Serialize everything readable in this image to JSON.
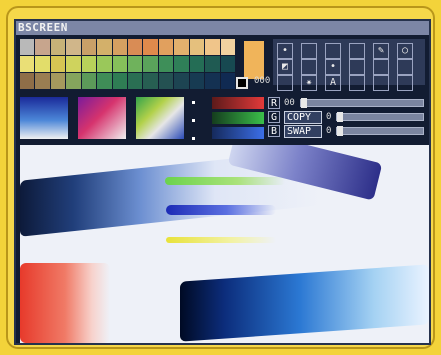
{
  "window": {
    "title": "BSCREEN"
  },
  "palette": {
    "rows": [
      [
        "#b9b9b9",
        "#c7a58d",
        "#c7b278",
        "#d0b68a",
        "#c9a068",
        "#d3b06a",
        "#d6a061",
        "#d98c55",
        "#e08a4c",
        "#e1a05e",
        "#e2b06d",
        "#e5c07d",
        "#f0c58a",
        "#f1d2a0"
      ],
      [
        "#eadf76",
        "#e2dd6a",
        "#d6c553",
        "#cfd35d",
        "#b8d25a",
        "#9ac85a",
        "#86c05a",
        "#6fb25c",
        "#5aa35b",
        "#3e8f59",
        "#2f7f58",
        "#246d55",
        "#1f5a52",
        "#174951"
      ],
      [
        "#8f6e48",
        "#9a7e52",
        "#a5995d",
        "#85a55d",
        "#5c9a59",
        "#3f8d57",
        "#2f7d54",
        "#2a6f53",
        "#275f52",
        "#245152",
        "#1d4452",
        "#173b52",
        "#143152",
        "#102a52"
      ]
    ]
  },
  "current_color": {
    "selected": "#f0b45a",
    "digits": "000"
  },
  "tools": [
    {
      "name": "brush-dots-tool",
      "glyph": "•"
    },
    {
      "name": "blank-tool-1",
      "glyph": ""
    },
    {
      "name": "blank-tool-2",
      "glyph": ""
    },
    {
      "name": "blank-tool-3",
      "glyph": ""
    },
    {
      "name": "pencil-tool",
      "glyph": "✎"
    },
    {
      "name": "circle-tool",
      "glyph": "○"
    },
    {
      "name": "fill-tool",
      "glyph": "◩"
    },
    {
      "name": "blank-tool-4",
      "glyph": ""
    },
    {
      "name": "stamp-tool",
      "glyph": "•"
    },
    {
      "name": "blank-tool-5",
      "glyph": ""
    },
    {
      "name": "blank-tool-6",
      "glyph": ""
    },
    {
      "name": "blank-tool-7",
      "glyph": ""
    },
    {
      "name": "blank-tool-8",
      "glyph": ""
    },
    {
      "name": "spray-tool",
      "glyph": "✷"
    },
    {
      "name": "text-tool",
      "glyph": "A"
    },
    {
      "name": "blank-tool-9",
      "glyph": ""
    },
    {
      "name": "blank-tool-10",
      "glyph": ""
    },
    {
      "name": "blank-tool-11",
      "glyph": ""
    }
  ],
  "rgb": {
    "labels": [
      "R",
      "G",
      "B"
    ],
    "r_value": "00",
    "copy_label": "COPY",
    "copy_value": "0",
    "swap_label": "SWAP",
    "swap_value": "0"
  },
  "accent_colors": {
    "title_bar": "#7c86a6",
    "panel": "#2e3a58",
    "screen": "#121c32"
  }
}
